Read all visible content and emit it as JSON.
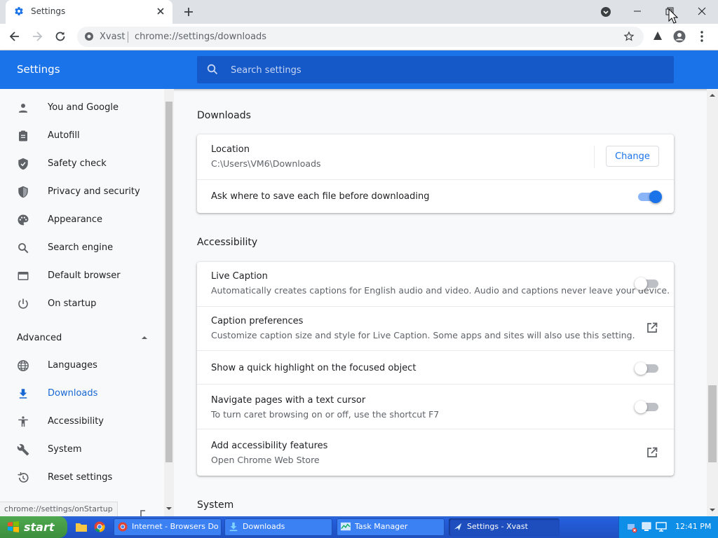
{
  "browser": {
    "tab_title": "Settings",
    "site_label": "Xvast",
    "url": "chrome://settings/downloads"
  },
  "settings": {
    "header_title": "Settings",
    "search_placeholder": "Search settings"
  },
  "sidebar": {
    "items": [
      {
        "label": "You and Google",
        "icon": "person-icon"
      },
      {
        "label": "Autofill",
        "icon": "clipboard-icon"
      },
      {
        "label": "Safety check",
        "icon": "shield-check-icon"
      },
      {
        "label": "Privacy and security",
        "icon": "shield-icon"
      },
      {
        "label": "Appearance",
        "icon": "palette-icon"
      },
      {
        "label": "Search engine",
        "icon": "search-icon"
      },
      {
        "label": "Default browser",
        "icon": "browser-icon"
      },
      {
        "label": "On startup",
        "icon": "power-icon"
      }
    ],
    "advanced_label": "Advanced",
    "advanced_items": [
      {
        "label": "Languages",
        "icon": "globe-icon"
      },
      {
        "label": "Downloads",
        "icon": "download-icon",
        "active": true
      },
      {
        "label": "Accessibility",
        "icon": "accessibility-icon"
      },
      {
        "label": "System",
        "icon": "wrench-icon"
      },
      {
        "label": "Reset settings",
        "icon": "history-icon"
      }
    ]
  },
  "downloads": {
    "section_title": "Downloads",
    "location_label": "Location",
    "location_value": "C:\\Users\\VM6\\Downloads",
    "change_label": "Change",
    "ask_label": "Ask where to save each file before downloading",
    "ask_enabled": true
  },
  "accessibility": {
    "section_title": "Accessibility",
    "live_caption_label": "Live Caption",
    "live_caption_desc": "Automatically creates captions for English audio and video. Audio and captions never leave your device.",
    "live_caption_enabled": false,
    "caption_prefs_label": "Caption preferences",
    "caption_prefs_desc": "Customize caption size and style for Live Caption. Some apps and sites will also use this setting.",
    "highlight_label": "Show a quick highlight on the focused object",
    "highlight_enabled": false,
    "caret_label": "Navigate pages with a text cursor",
    "caret_desc": "To turn caret browsing on or off, use the shortcut F7",
    "caret_enabled": false,
    "add_features_label": "Add accessibility features",
    "add_features_desc": "Open Chrome Web Store"
  },
  "system": {
    "section_title": "System"
  },
  "status_bar": {
    "text": "chrome://settings/onStartup"
  },
  "taskbar": {
    "start_label": "start",
    "tasks": [
      {
        "label": "Internet - Browsers Do..."
      },
      {
        "label": "Downloads"
      },
      {
        "label": "Task Manager"
      },
      {
        "label": "Settings - Xvast"
      }
    ],
    "clock": "12:41 PM"
  },
  "colors": {
    "accent": "#1a73e8",
    "header_bg": "#1a73e8",
    "taskbar_bg": "#245edb"
  }
}
